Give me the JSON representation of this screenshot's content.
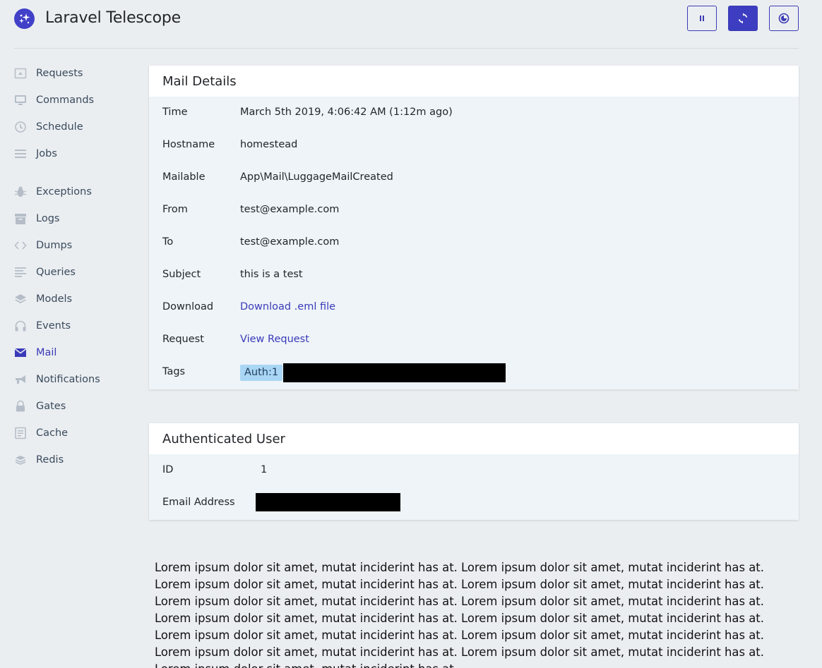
{
  "app": {
    "title": "Laravel Telescope"
  },
  "header_buttons": [
    {
      "name": "pause",
      "icon": "pause-icon"
    },
    {
      "name": "refresh",
      "icon": "refresh-icon"
    },
    {
      "name": "theme",
      "icon": "theme-icon"
    }
  ],
  "sidebar": {
    "items": [
      {
        "label": "Requests",
        "icon": "requests-icon"
      },
      {
        "label": "Commands",
        "icon": "monitor-icon"
      },
      {
        "label": "Schedule",
        "icon": "clock-icon"
      },
      {
        "label": "Jobs",
        "icon": "list-icon"
      },
      {
        "label": "Exceptions",
        "icon": "bug-icon"
      },
      {
        "label": "Logs",
        "icon": "archive-icon"
      },
      {
        "label": "Dumps",
        "icon": "code-icon"
      },
      {
        "label": "Queries",
        "icon": "lines-icon"
      },
      {
        "label": "Models",
        "icon": "layers-icon"
      },
      {
        "label": "Events",
        "icon": "headphones-icon"
      },
      {
        "label": "Mail",
        "icon": "envelope-icon",
        "active": true
      },
      {
        "label": "Notifications",
        "icon": "megaphone-icon"
      },
      {
        "label": "Gates",
        "icon": "lock-icon"
      },
      {
        "label": "Cache",
        "icon": "note-icon"
      },
      {
        "label": "Redis",
        "icon": "stack-icon"
      }
    ]
  },
  "mail_details": {
    "title": "Mail Details",
    "rows": [
      {
        "key": "Time",
        "value": "March 5th 2019, 4:06:42 AM (1:12m ago)"
      },
      {
        "key": "Hostname",
        "value": "homestead"
      },
      {
        "key": "Mailable",
        "value": "App\\Mail\\LuggageMailCreated"
      },
      {
        "key": "From",
        "value": "test@example.com"
      },
      {
        "key": "To",
        "value": "test@example.com"
      },
      {
        "key": "Subject",
        "value": "this is a test"
      },
      {
        "key": "Download",
        "value": "Download .eml file"
      },
      {
        "key": "Request",
        "value": "View Request"
      },
      {
        "key": "Tags",
        "value": "Auth:1"
      }
    ]
  },
  "authenticated_user": {
    "title": "Authenticated User",
    "rows": [
      {
        "key": "ID",
        "value": "1"
      },
      {
        "key": "Email Address",
        "value": ""
      }
    ]
  },
  "body_text": "Lorem ipsum dolor sit amet, mutat inciderint has at. Lorem ipsum dolor sit amet, mutat inciderint has at. Lorem ipsum dolor sit amet, mutat inciderint has at. Lorem ipsum dolor sit amet, mutat inciderint has at. Lorem ipsum dolor sit amet, mutat inciderint has at. Lorem ipsum dolor sit amet, mutat inciderint has at. Lorem ipsum dolor sit amet, mutat inciderint has at. Lorem ipsum dolor sit amet, mutat inciderint has at. Lorem ipsum dolor sit amet, mutat inciderint has at. Lorem ipsum dolor sit amet, mutat inciderint has at. Lorem ipsum dolor sit amet, mutat inciderint has at. Lorem ipsum dolor sit amet, mutat inciderint has at. Lorem ipsum dolor sit amet, mutat inciderint has at.",
  "colors": {
    "accent": "#3d3dc1",
    "sidebar_text": "#394a5c",
    "tag_bg": "#a9d6f4",
    "page_bg": "#ebeef1"
  }
}
